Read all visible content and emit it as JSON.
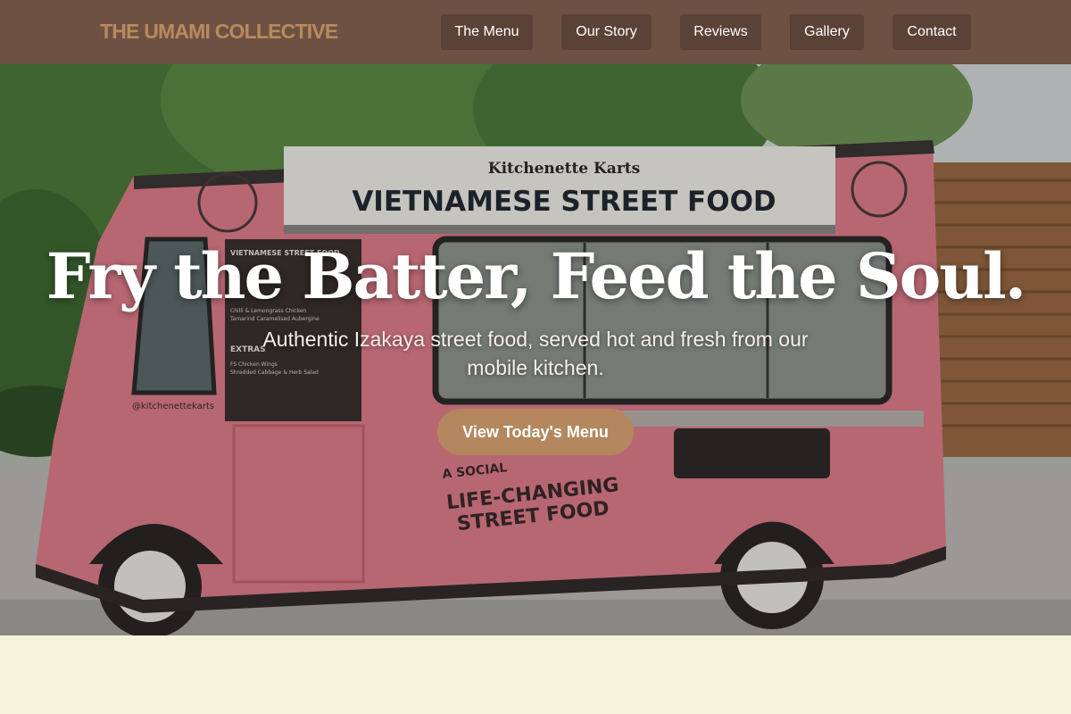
{
  "nav": {
    "brand": "THE UMAMI COLLECTIVE",
    "items": [
      {
        "label": "The Menu"
      },
      {
        "label": "Our Story"
      },
      {
        "label": "Reviews"
      },
      {
        "label": "Gallery"
      },
      {
        "label": "Contact"
      }
    ]
  },
  "hero": {
    "title": "Fry the Batter, Feed the Soul.",
    "subtitle": "Authentic Izakaya street food, served hot and fresh from our mobile kitchen.",
    "cta": "View Today's Menu",
    "truck": {
      "brand": "Kitchenette Karts",
      "headline": "VIETNAMESE STREET FOOD",
      "tagline_1": "A SOCIAL",
      "tagline_2": "LIFE-CHANGING",
      "tagline_3": "STREET FOOD",
      "handle": "@kitchenettekarts",
      "menu_board_title": "VIETNAMESE STREET FOOD",
      "menu_board_extras": "EXTRAS",
      "menu_board_lines": [
        "Chilli & Lemongrass Chicken",
        "Tamarind Caramelised Aubergine",
        "FS Chicken Wings",
        "Shredded Cabbage & Herb Salad"
      ]
    }
  },
  "colors": {
    "nav_bg": "#6d5243",
    "nav_button": "#5b4236",
    "brand": "#b98a5e",
    "cta": "#b4875e",
    "page_bg": "#f5f3dc"
  }
}
